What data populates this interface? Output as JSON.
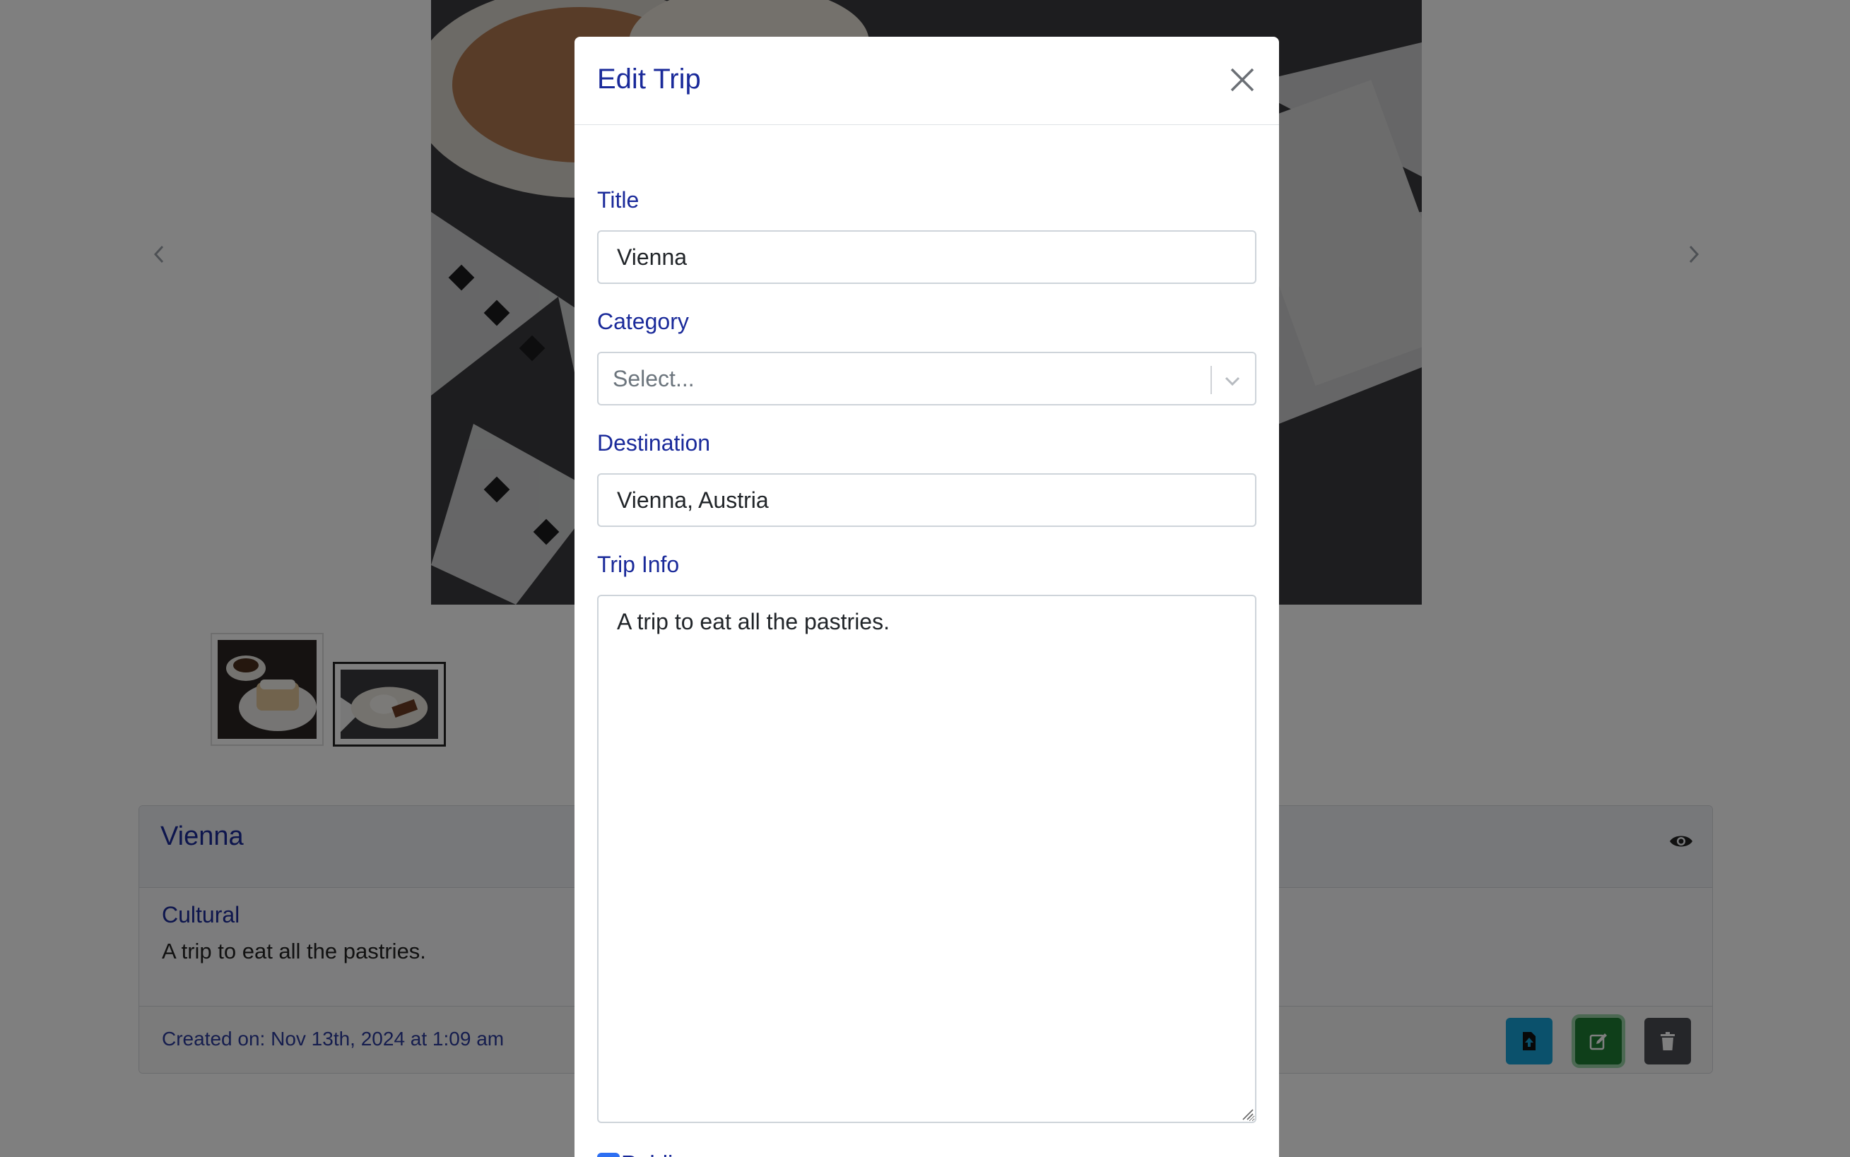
{
  "modal": {
    "title": "Edit Trip",
    "fields": {
      "title_label": "Title",
      "title_value": "Vienna",
      "category_label": "Category",
      "category_placeholder": "Select...",
      "destination_label": "Destination",
      "destination_value": "Vienna, Austria",
      "trip_info_label": "Trip Info",
      "trip_info_value": "A trip to eat all the pastries.",
      "public_label": "Public",
      "public_checked": true
    },
    "icons": {
      "close": "close-icon",
      "chevron": "chevron-down-icon",
      "check": "check-icon"
    }
  },
  "background": {
    "card": {
      "title": "Vienna",
      "category": "Cultural",
      "info": "A trip to eat all the pastries.",
      "created": "Created on: Nov 13th, 2024 at 1:09 am"
    },
    "icons": {
      "visibility": "eye-icon",
      "export": "file-export-icon",
      "edit": "edit-icon",
      "delete": "trash-icon",
      "prev": "chevron-left-icon",
      "next": "chevron-right-icon"
    }
  },
  "colors": {
    "accent_text": "#1a2a9a",
    "checkbox": "#2d6ff2",
    "export_button": "#17a2d8",
    "edit_button": "#1e7e34",
    "delete_button": "#4a4d52"
  }
}
